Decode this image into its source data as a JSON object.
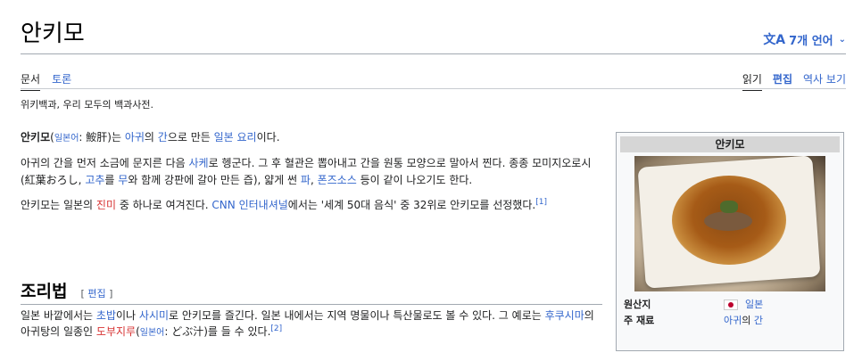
{
  "page": {
    "title": "안키모",
    "language_button": "7개 언어"
  },
  "tabs": {
    "left": [
      "문서",
      "토론"
    ],
    "right": [
      "읽기",
      "편집",
      "역사 보기"
    ]
  },
  "tagline": "위키백과, 우리 모두의 백과사전.",
  "paragraph1": {
    "bold": "안키모",
    "lang_open": "(",
    "lang_link": "일본어",
    "lang_rest": ": 鮟肝)는 ",
    "link1": "아귀",
    "t1": "의 ",
    "link2": "간",
    "t2": "으로 만든 ",
    "link3": "일본 요리",
    "t3": "이다."
  },
  "paragraph2": {
    "t1": "아귀의 간을 먼저 소금에 문지른 다음 ",
    "link1": "사케",
    "t2": "로 헹군다. 그 후 혈관은 뽑아내고 간을 원통 모양으로 말아서 찐다. 종종 모미지오로시(紅葉おろし, ",
    "link2": "고추",
    "t3": "를 ",
    "link3": "무",
    "t4": "와 함께 강판에 갈아 만든 즙), 얇게 썬 ",
    "link4": "파",
    "t5": ", ",
    "link5": "폰즈소스",
    "t6": " 등이 같이 나오기도 한다."
  },
  "paragraph3": {
    "t1": "안키모는 일본의 ",
    "link1": "진미",
    "t2": " 중 하나로 여겨진다. ",
    "link2": "CNN 인터내셔널",
    "t3": "에서는 '세계 50대 음식' 중 32위로 안키모를 선정했다.",
    "ref": "[1]"
  },
  "section": {
    "heading": "조리법",
    "edit_open": "[ ",
    "edit_label": "편집",
    "edit_close": " ]"
  },
  "paragraph4": {
    "t1": "일본 바깥에서는 ",
    "link1": "초밥",
    "t2": "이나 ",
    "link2": "사시미",
    "t3": "로 안키모를 즐긴다. 일본 내에서는 지역 명물이나 특산물로도 볼 수 있다. 그 예로는 ",
    "link3": "후쿠시마",
    "t4": "의 아귀탕의 일종인 ",
    "link4": "도부지루",
    "t5": "(",
    "lang_link": "일본어",
    "t6": ": どぶ汁)를 들 수 있다.",
    "ref": "[2]"
  },
  "infobox": {
    "title": "안키모",
    "rows": [
      {
        "label": "원산지",
        "value": "일본"
      },
      {
        "label": "주 재료",
        "value_link": "아귀",
        "value_mid": "의 ",
        "value_link2": "간"
      }
    ]
  }
}
